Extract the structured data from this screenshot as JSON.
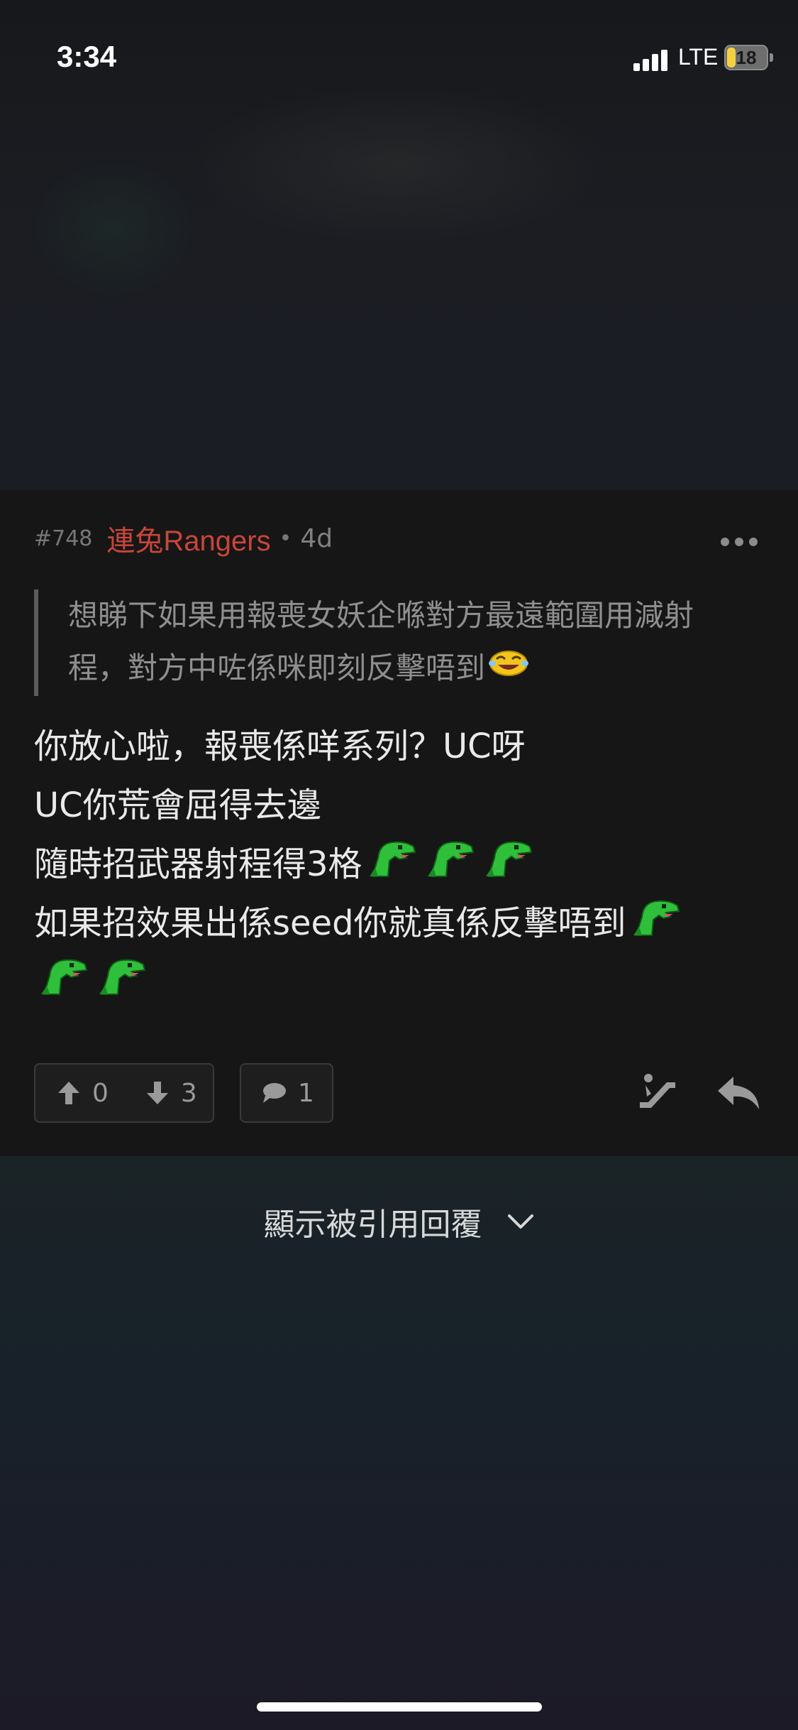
{
  "status_bar": {
    "time": "3:34",
    "network": "LTE",
    "battery": "18"
  },
  "post": {
    "number": "#748",
    "author": "連兔Rangers",
    "separator": "•",
    "age": "4d",
    "quote_lines": [
      "想睇下如果用報喪女妖企喺對方最遠範圍用減射",
      "程，對方中咗係咪即刻反擊唔到"
    ],
    "body_lines": [
      "你放心啦，報喪係咩系列？UC呀",
      "UC你荒會屈得去邊",
      "隨時招武器射程得3格",
      "如果招效果出係seed你就真係反擊唔到"
    ],
    "emojis": {
      "quote_end": "laughing-emoji",
      "line3": [
        "dinosaur-emoji",
        "dinosaur-emoji",
        "dinosaur-emoji"
      ],
      "line4": [
        "dinosaur-emoji"
      ],
      "line5": [
        "dinosaur-emoji",
        "dinosaur-emoji"
      ]
    },
    "upvotes": "0",
    "downvotes": "3",
    "comments": "1"
  },
  "show_quoted_label": "顯示被引用回覆",
  "colors": {
    "author": "#c9453a",
    "card_bg": "#161616",
    "dino_green": "#2fbf3a"
  }
}
